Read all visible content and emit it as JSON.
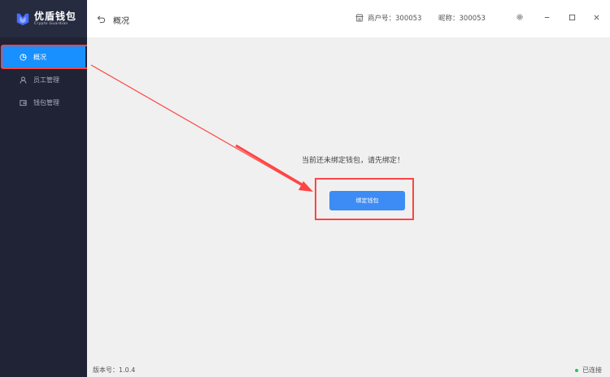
{
  "app": {
    "logo_title": "优盾钱包",
    "logo_subtitle": "Crypto Guardian"
  },
  "sidebar": {
    "items": [
      {
        "label": "概况",
        "icon": "pie-chart-icon",
        "active": true
      },
      {
        "label": "员工管理",
        "icon": "user-icon",
        "active": false
      },
      {
        "label": "钱包管理",
        "icon": "wallet-icon",
        "active": false
      }
    ]
  },
  "header": {
    "title": "概况",
    "merchant_label": "商户号：300053",
    "nickname_label": "昵称：300053"
  },
  "main": {
    "empty_message": "当前还未绑定钱包，请先绑定！",
    "bind_button_label": "绑定钱包"
  },
  "footer": {
    "version_label": "版本号：1.0.4",
    "connection_status": "已连接"
  },
  "colors": {
    "sidebar_bg": "#1f2335",
    "accent": "#1890ff",
    "button": "#3d8cf5",
    "highlight": "#ff4545",
    "connected": "#22c55e"
  }
}
